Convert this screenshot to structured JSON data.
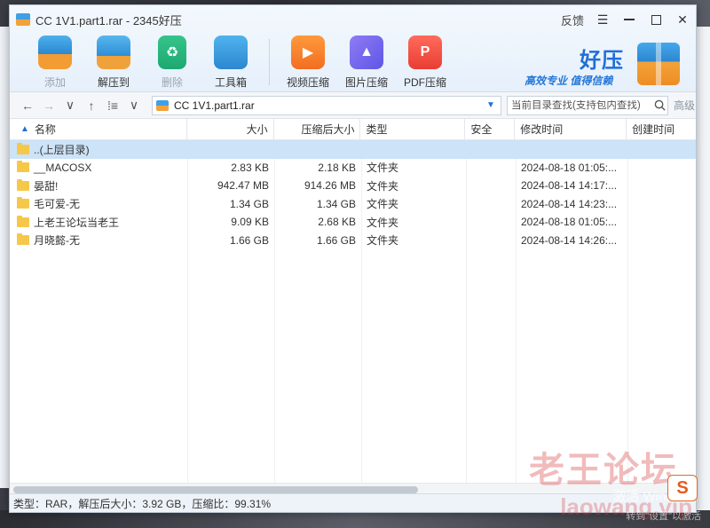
{
  "window": {
    "title": "CC 1V1.part1.rar - 2345好压",
    "feedback": "反馈",
    "menu_glyph": "☰",
    "minimize_label": "",
    "close_glyph": "✕"
  },
  "toolbar": {
    "add": "添加",
    "extract": "解压到",
    "delete": "删除",
    "tools": "工具箱",
    "video": "视频压缩",
    "image": "图片压缩",
    "pdf": "PDF压缩"
  },
  "brand": {
    "name": "好压",
    "slogan": "高效专业  值得信赖"
  },
  "address": {
    "back": "←",
    "forward": "→",
    "dropdown": "∨",
    "up": "↑",
    "view": "⁞≡",
    "path": "CC 1V1.part1.rar",
    "search_placeholder": "当前目录查找(支持包内查找)",
    "advanced": "高级"
  },
  "columns": {
    "name": "名称",
    "size": "大小",
    "compressed": "压缩后大小",
    "type": "类型",
    "security": "安全",
    "modified": "修改时间",
    "created": "创建时间"
  },
  "rows": [
    {
      "name": "..(上层目录)",
      "size": "",
      "compressed": "",
      "type": "",
      "modified": ""
    },
    {
      "name": "__MACOSX",
      "size": "2.83 KB",
      "compressed": "2.18 KB",
      "type": "文件夹",
      "modified": "2024-08-18 01:05:..."
    },
    {
      "name": "晏甜!",
      "size": "942.47 MB",
      "compressed": "914.26 MB",
      "type": "文件夹",
      "modified": "2024-08-14 14:17:..."
    },
    {
      "name": "毛可爱-无",
      "size": "1.34 GB",
      "compressed": "1.34 GB",
      "type": "文件夹",
      "modified": "2024-08-14 14:23:..."
    },
    {
      "name": "上老王论坛当老王",
      "size": "9.09 KB",
      "compressed": "2.68 KB",
      "type": "文件夹",
      "modified": "2024-08-18 01:05:..."
    },
    {
      "name": "月晓懿-无",
      "size": "1.66 GB",
      "compressed": "1.66 GB",
      "type": "文件夹",
      "modified": "2024-08-14 14:26:..."
    }
  ],
  "status": {
    "text": "类型：RAR，解压后大小：3.92 GB，压缩比：99.31%"
  },
  "desktop": {
    "activate": "激活 Window",
    "activate_sub": "转到\"设置\"以激活",
    "watermark": "老王论坛",
    "watermark_url": "laowang.vip",
    "sogou": "S"
  }
}
